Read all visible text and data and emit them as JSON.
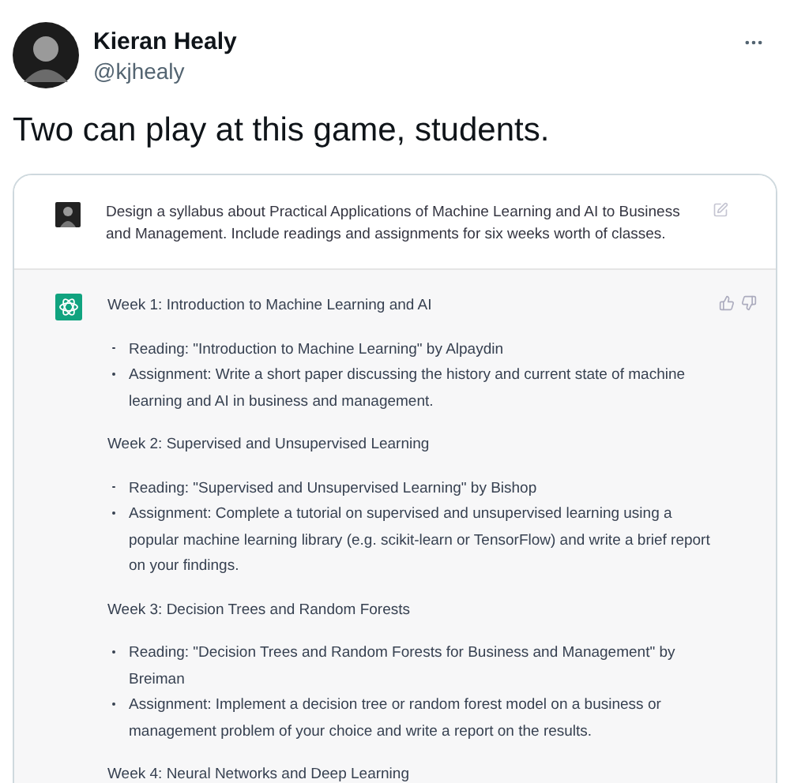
{
  "tweet": {
    "author_name": "Kieran Healy",
    "handle": "@kjhealy",
    "text": "Two can play at this game, students."
  },
  "chat": {
    "prompt": "Design a syllabus about Practical Applications of Machine Learning and AI to Business and Management. Include readings and assignments for six weeks worth of classes.",
    "weeks": [
      {
        "title": "Week 1: Introduction to Machine Learning and AI",
        "items": [
          "Reading: \"Introduction to Machine Learning\" by Alpaydin",
          "Assignment: Write a short paper discussing the history and current state of machine learning and AI in business and management."
        ]
      },
      {
        "title": "Week 2: Supervised and Unsupervised Learning",
        "items": [
          "Reading: \"Supervised and Unsupervised Learning\" by Bishop",
          "Assignment: Complete a tutorial on supervised and unsupervised learning using a popular machine learning library (e.g. scikit-learn or TensorFlow) and write a brief report on your findings."
        ]
      },
      {
        "title": "Week 3: Decision Trees and Random Forests",
        "items": [
          "Reading: \"Decision Trees and Random Forests for Business and Management\" by Breiman",
          "Assignment: Implement a decision tree or random forest model on a business or management problem of your choice and write a report on the results."
        ]
      },
      {
        "title": "Week 4: Neural Networks and Deep Learning"
      }
    ]
  }
}
